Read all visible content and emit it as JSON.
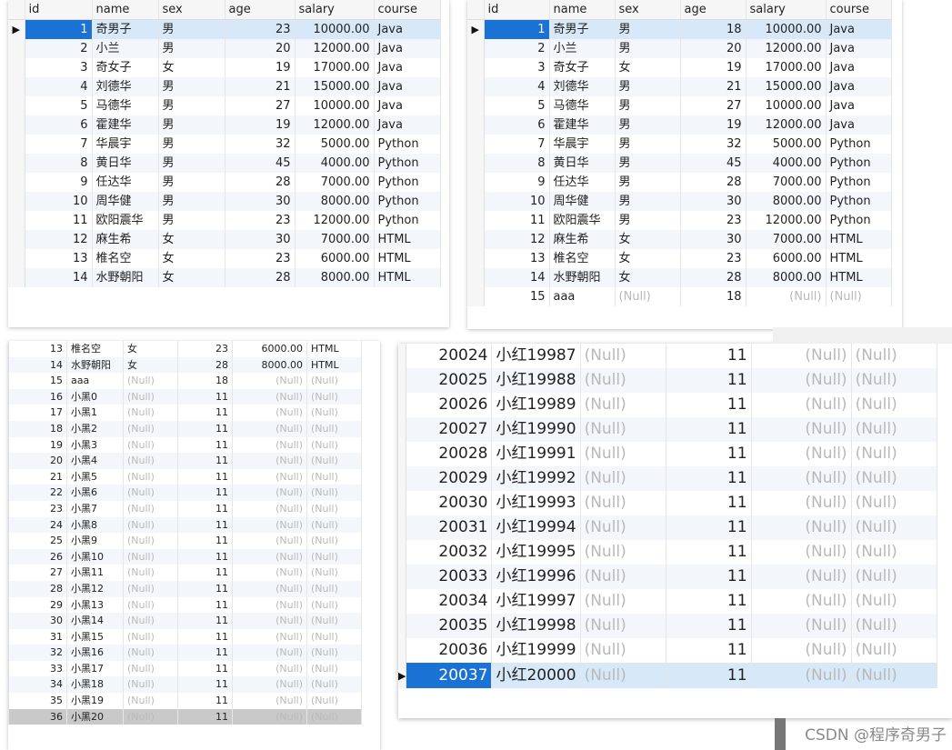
{
  "columns": [
    "id",
    "name",
    "sex",
    "age",
    "salary",
    "course"
  ],
  "null_text": "(Null)",
  "panel1": {
    "rows": [
      [
        "1",
        "奇男子",
        "男",
        "23",
        "10000.00",
        "Java"
      ],
      [
        "2",
        "小兰",
        "男",
        "20",
        "12000.00",
        "Java"
      ],
      [
        "3",
        "奇女子",
        "女",
        "19",
        "17000.00",
        "Java"
      ],
      [
        "4",
        "刘德华",
        "男",
        "21",
        "15000.00",
        "Java"
      ],
      [
        "5",
        "马德华",
        "男",
        "27",
        "10000.00",
        "Java"
      ],
      [
        "6",
        "霍建华",
        "男",
        "19",
        "12000.00",
        "Java"
      ],
      [
        "7",
        "华晨宇",
        "男",
        "32",
        "5000.00",
        "Python"
      ],
      [
        "8",
        "黄日华",
        "男",
        "45",
        "4000.00",
        "Python"
      ],
      [
        "9",
        "任达华",
        "男",
        "28",
        "7000.00",
        "Python"
      ],
      [
        "10",
        "周华健",
        "男",
        "30",
        "8000.00",
        "Python"
      ],
      [
        "11",
        "欧阳震华",
        "男",
        "23",
        "12000.00",
        "Python"
      ],
      [
        "12",
        "麻生希",
        "女",
        "30",
        "7000.00",
        "HTML"
      ],
      [
        "13",
        "椎名空",
        "女",
        "23",
        "6000.00",
        "HTML"
      ],
      [
        "14",
        "水野朝阳",
        "女",
        "28",
        "8000.00",
        "HTML"
      ]
    ]
  },
  "panel2": {
    "rows": [
      [
        "1",
        "奇男子",
        "男",
        "18",
        "10000.00",
        "Java"
      ],
      [
        "2",
        "小兰",
        "男",
        "20",
        "12000.00",
        "Java"
      ],
      [
        "3",
        "奇女子",
        "女",
        "19",
        "17000.00",
        "Java"
      ],
      [
        "4",
        "刘德华",
        "男",
        "21",
        "15000.00",
        "Java"
      ],
      [
        "5",
        "马德华",
        "男",
        "27",
        "10000.00",
        "Java"
      ],
      [
        "6",
        "霍建华",
        "男",
        "19",
        "12000.00",
        "Java"
      ],
      [
        "7",
        "华晨宇",
        "男",
        "32",
        "5000.00",
        "Python"
      ],
      [
        "8",
        "黄日华",
        "男",
        "45",
        "4000.00",
        "Python"
      ],
      [
        "9",
        "任达华",
        "男",
        "28",
        "7000.00",
        "Python"
      ],
      [
        "10",
        "周华健",
        "男",
        "30",
        "8000.00",
        "Python"
      ],
      [
        "11",
        "欧阳震华",
        "男",
        "23",
        "12000.00",
        "Python"
      ],
      [
        "12",
        "麻生希",
        "女",
        "30",
        "7000.00",
        "HTML"
      ],
      [
        "13",
        "椎名空",
        "女",
        "23",
        "6000.00",
        "HTML"
      ],
      [
        "14",
        "水野朝阳",
        "女",
        "28",
        "8000.00",
        "HTML"
      ],
      [
        "15",
        "aaa",
        "(Null)",
        "18",
        "(Null)",
        "(Null)"
      ]
    ]
  },
  "panel3": {
    "rows": [
      [
        "13",
        "椎名空",
        "女",
        "23",
        "6000.00",
        "HTML"
      ],
      [
        "14",
        "水野朝阳",
        "女",
        "28",
        "8000.00",
        "HTML"
      ],
      [
        "15",
        "aaa",
        "(Null)",
        "18",
        "(Null)",
        "(Null)"
      ],
      [
        "16",
        "小黑0",
        "(Null)",
        "11",
        "(Null)",
        "(Null)"
      ],
      [
        "17",
        "小黑1",
        "(Null)",
        "11",
        "(Null)",
        "(Null)"
      ],
      [
        "18",
        "小黑2",
        "(Null)",
        "11",
        "(Null)",
        "(Null)"
      ],
      [
        "19",
        "小黑3",
        "(Null)",
        "11",
        "(Null)",
        "(Null)"
      ],
      [
        "20",
        "小黑4",
        "(Null)",
        "11",
        "(Null)",
        "(Null)"
      ],
      [
        "21",
        "小黑5",
        "(Null)",
        "11",
        "(Null)",
        "(Null)"
      ],
      [
        "22",
        "小黑6",
        "(Null)",
        "11",
        "(Null)",
        "(Null)"
      ],
      [
        "23",
        "小黑7",
        "(Null)",
        "11",
        "(Null)",
        "(Null)"
      ],
      [
        "24",
        "小黑8",
        "(Null)",
        "11",
        "(Null)",
        "(Null)"
      ],
      [
        "25",
        "小黑9",
        "(Null)",
        "11",
        "(Null)",
        "(Null)"
      ],
      [
        "26",
        "小黑10",
        "(Null)",
        "11",
        "(Null)",
        "(Null)"
      ],
      [
        "27",
        "小黑11",
        "(Null)",
        "11",
        "(Null)",
        "(Null)"
      ],
      [
        "28",
        "小黑12",
        "(Null)",
        "11",
        "(Null)",
        "(Null)"
      ],
      [
        "29",
        "小黑13",
        "(Null)",
        "11",
        "(Null)",
        "(Null)"
      ],
      [
        "30",
        "小黑14",
        "(Null)",
        "11",
        "(Null)",
        "(Null)"
      ],
      [
        "31",
        "小黑15",
        "(Null)",
        "11",
        "(Null)",
        "(Null)"
      ],
      [
        "32",
        "小黑16",
        "(Null)",
        "11",
        "(Null)",
        "(Null)"
      ],
      [
        "33",
        "小黑17",
        "(Null)",
        "11",
        "(Null)",
        "(Null)"
      ],
      [
        "34",
        "小黑18",
        "(Null)",
        "11",
        "(Null)",
        "(Null)"
      ],
      [
        "35",
        "小黑19",
        "(Null)",
        "11",
        "(Null)",
        "(Null)"
      ],
      [
        "36",
        "小黑20",
        "(Null)",
        "11",
        "(Null)",
        "(Null)"
      ]
    ]
  },
  "panel4": {
    "rows": [
      [
        "20024",
        "小红19987",
        "(Null)",
        "11",
        "(Null)",
        "(Null)"
      ],
      [
        "20025",
        "小红19988",
        "(Null)",
        "11",
        "(Null)",
        "(Null)"
      ],
      [
        "20026",
        "小红19989",
        "(Null)",
        "11",
        "(Null)",
        "(Null)"
      ],
      [
        "20027",
        "小红19990",
        "(Null)",
        "11",
        "(Null)",
        "(Null)"
      ],
      [
        "20028",
        "小红19991",
        "(Null)",
        "11",
        "(Null)",
        "(Null)"
      ],
      [
        "20029",
        "小红19992",
        "(Null)",
        "11",
        "(Null)",
        "(Null)"
      ],
      [
        "20030",
        "小红19993",
        "(Null)",
        "11",
        "(Null)",
        "(Null)"
      ],
      [
        "20031",
        "小红19994",
        "(Null)",
        "11",
        "(Null)",
        "(Null)"
      ],
      [
        "20032",
        "小红19995",
        "(Null)",
        "11",
        "(Null)",
        "(Null)"
      ],
      [
        "20033",
        "小红19996",
        "(Null)",
        "11",
        "(Null)",
        "(Null)"
      ],
      [
        "20034",
        "小红19997",
        "(Null)",
        "11",
        "(Null)",
        "(Null)"
      ],
      [
        "20035",
        "小红19998",
        "(Null)",
        "11",
        "(Null)",
        "(Null)"
      ],
      [
        "20036",
        "小红19999",
        "(Null)",
        "11",
        "(Null)",
        "(Null)"
      ],
      [
        "20037",
        "小红20000",
        "(Null)",
        "11",
        "(Null)",
        "(Null)"
      ]
    ]
  },
  "watermark": "CSDN @程序奇男子",
  "colors": {
    "selected_row": "#d7e8f8",
    "selected_id_cell": "#1a73d4",
    "null_text": "#b9b9b9"
  }
}
